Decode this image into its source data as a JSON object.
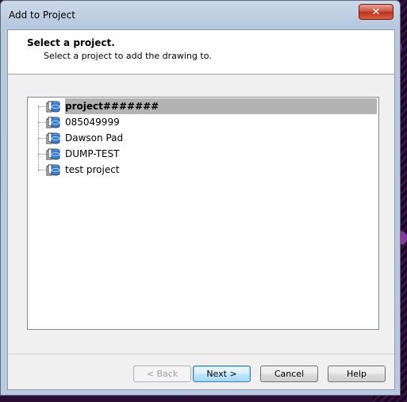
{
  "window": {
    "title": "Add to Project",
    "close_glyph": "✕"
  },
  "header": {
    "title": "Select a project.",
    "subtitle": "Select a project to add the drawing to."
  },
  "tree": {
    "items": [
      {
        "label": "project#######",
        "selected": true,
        "icon": "project-icon"
      },
      {
        "label": "085049999",
        "selected": false,
        "icon": "project-icon"
      },
      {
        "label": "Dawson Pad",
        "selected": false,
        "icon": "project-icon"
      },
      {
        "label": "DUMP-TEST",
        "selected": false,
        "icon": "project-icon"
      },
      {
        "label": "test project",
        "selected": false,
        "icon": "project-icon"
      }
    ]
  },
  "buttons": {
    "back": "< Back",
    "next": "Next >",
    "cancel": "Cancel",
    "help": "Help"
  },
  "colors": {
    "selection": "#b3b3b3",
    "titlebar": "#b9cadf",
    "close": "#c74b36",
    "icon_blue": "#3b7bc8"
  }
}
